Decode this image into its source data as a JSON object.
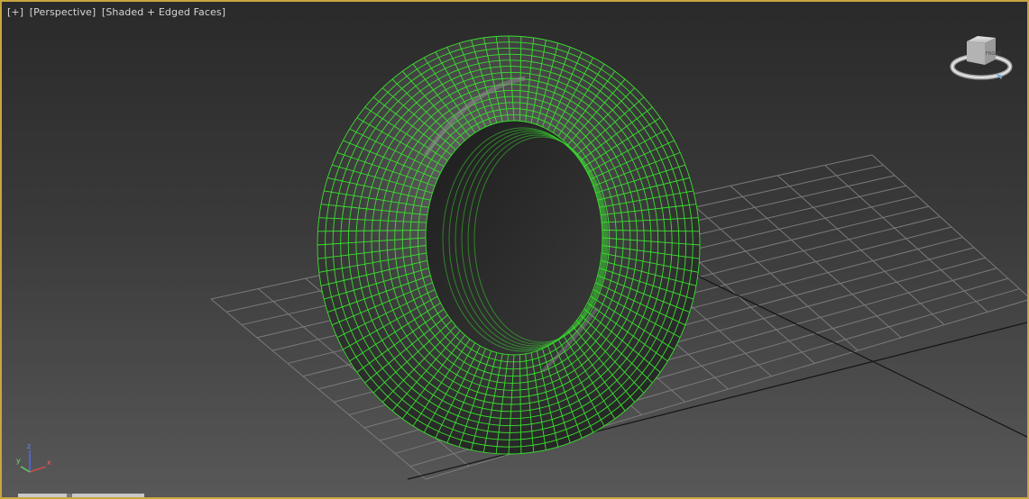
{
  "viewport": {
    "label_plus": "[+]",
    "label_view": "[Perspective]",
    "label_shading": "[Shaded + Edged Faces]",
    "border_color": "#c8a640"
  },
  "viewcube": {
    "face_label": "FRONT",
    "icon": "viewcube-icon"
  },
  "axis_tripod": {
    "z": "z",
    "y": "y",
    "x": "x",
    "colors": {
      "z": "#4a6cff",
      "y": "#5fd35f",
      "x": "#e04848"
    }
  },
  "scene": {
    "object": "tire",
    "wire_color": "#39e02d",
    "grid_color": "#7a7a7a",
    "world_axis_color": "#111111"
  }
}
